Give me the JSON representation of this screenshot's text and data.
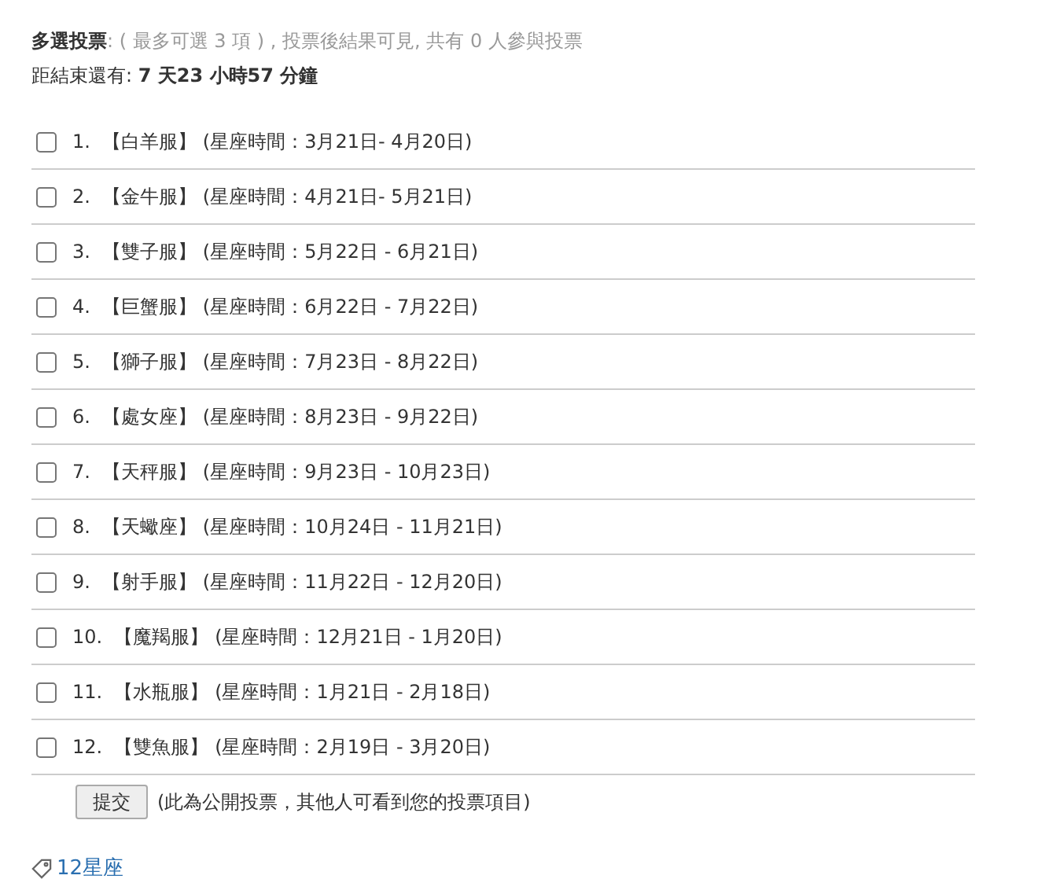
{
  "poll": {
    "title": "多選投票",
    "info": ": ( 最多可選 3 項 ) , 投票後結果可見, 共有 0 人參與投票"
  },
  "countdown": {
    "label": "距結束還有:",
    "value": "7 天23 小時57 分鐘"
  },
  "options": [
    {
      "number": "1.",
      "name": "【白羊服】",
      "period": "(星座時間：3月21日- 4月20日)",
      "checked": false
    },
    {
      "number": "2.",
      "name": "【金牛服】",
      "period": "(星座時間：4月21日- 5月21日)",
      "checked": false
    },
    {
      "number": "3.",
      "name": "【雙子服】",
      "period": "(星座時間：5月22日 - 6月21日)",
      "checked": false
    },
    {
      "number": "4.",
      "name": "【巨蟹服】",
      "period": "(星座時間：6月22日 - 7月22日)",
      "checked": false
    },
    {
      "number": "5.",
      "name": "【獅子服】",
      "period": "(星座時間：7月23日 - 8月22日)",
      "checked": false
    },
    {
      "number": "6.",
      "name": "【處女座】",
      "period": "(星座時間：8月23日 - 9月22日)",
      "checked": false
    },
    {
      "number": "7.",
      "name": "【天秤服】",
      "period": "(星座時間：9月23日 - 10月23日)",
      "checked": false
    },
    {
      "number": "8.",
      "name": "【天蠍座】",
      "period": "(星座時間：10月24日 - 11月21日)",
      "checked": false
    },
    {
      "number": "9.",
      "name": "【射手服】",
      "period": "(星座時間：11月22日 - 12月20日)",
      "checked": false
    },
    {
      "number": "10.",
      "name": "【魔羯服】",
      "period": "(星座時間：12月21日 - 1月20日)",
      "checked": false
    },
    {
      "number": "11.",
      "name": "【水瓶服】",
      "period": "(星座時間：1月21日 - 2月18日)",
      "checked": false
    },
    {
      "number": "12.",
      "name": "【雙魚服】",
      "period": "(星座時間：2月19日 - 3月20日)",
      "checked": false
    }
  ],
  "submit": {
    "label": "提交",
    "note": "(此為公開投票，其他人可看到您的投票項目)"
  },
  "tag": {
    "label": "12星座"
  }
}
